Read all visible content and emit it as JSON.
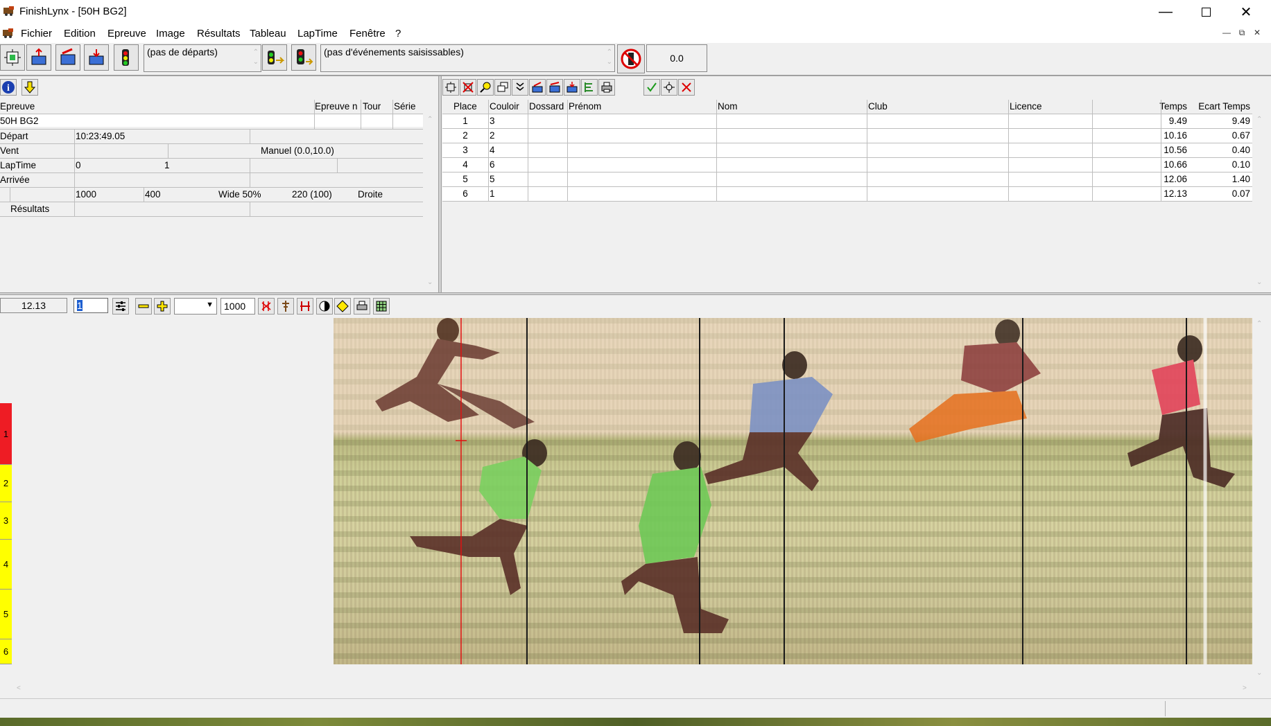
{
  "window": {
    "title": "FinishLynx - [50H BG2]"
  },
  "menu": [
    "Fichier",
    "Edition",
    "Epreuve",
    "Image",
    "Résultats",
    "Tableau",
    "LapTime",
    "Fenêtre",
    "?"
  ],
  "toolbar": {
    "starts_combo": "(pas de départs)",
    "events_combo": "(pas d'événements saisissables)",
    "wind_value": "0.0"
  },
  "event_panel": {
    "headers": {
      "epreuve": "Epreuve",
      "epreuve_n": "Epreuve n",
      "tour": "Tour",
      "serie": "Série"
    },
    "event_name": "50H BG2",
    "rows": {
      "depart_label": "Départ",
      "depart_value": "10:23:49.05",
      "vent_label": "Vent",
      "vent_value": "Manuel (0.0,10.0)",
      "laptime_label": "LapTime",
      "laptime_a": "0",
      "laptime_b": "1",
      "arrivee_label": "Arrivée",
      "params": [
        "1000",
        "400",
        "Wide 50%",
        "220  (100)",
        "Droite"
      ],
      "resultats_label": "Résultats"
    }
  },
  "results": {
    "columns": [
      "Place",
      "Couloir",
      "Dossard",
      "Prénom",
      "Nom",
      "Club",
      "Licence",
      "Temps",
      "Ecart Temps"
    ],
    "rows": [
      {
        "place": "1",
        "couloir": "3",
        "temps": "9.49",
        "ecart": "9.49"
      },
      {
        "place": "2",
        "couloir": "2",
        "temps": "10.16",
        "ecart": "0.67"
      },
      {
        "place": "3",
        "couloir": "4",
        "temps": "10.56",
        "ecart": "0.40"
      },
      {
        "place": "4",
        "couloir": "6",
        "temps": "10.66",
        "ecart": "0.10"
      },
      {
        "place": "5",
        "couloir": "5",
        "temps": "12.06",
        "ecart": "1.40"
      },
      {
        "place": "6",
        "couloir": "1",
        "temps": "12.13",
        "ecart": "0.07"
      }
    ]
  },
  "image_toolbar": {
    "time_value": "12.13",
    "frame_input": "1",
    "zoom_value": "1000"
  },
  "lanes": [
    "1",
    "2",
    "3",
    "4",
    "5",
    "6"
  ],
  "colors": {
    "lane1": "#ee1c24",
    "lanes_other": "#ffff00",
    "cursor": "#e01010"
  }
}
